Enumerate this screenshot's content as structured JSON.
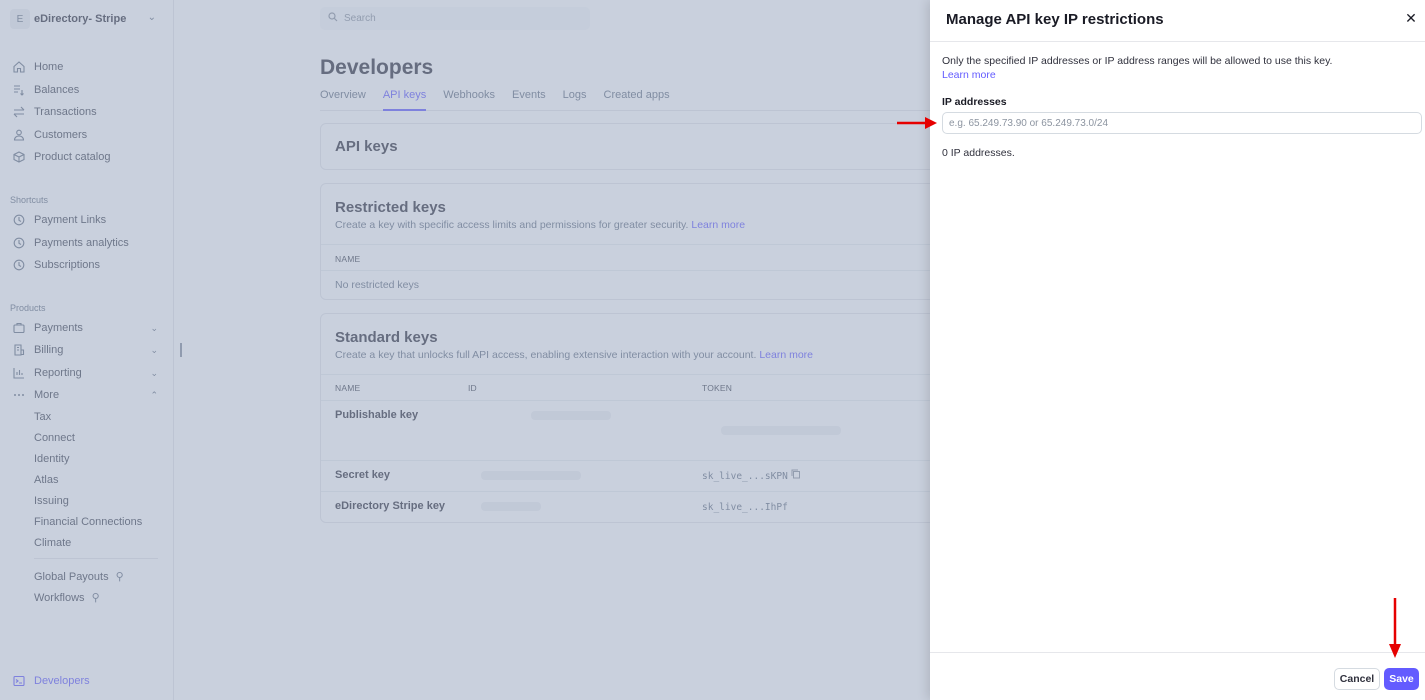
{
  "account": {
    "avatar_letter": "E",
    "name": "eDirectory- Stripe"
  },
  "search": {
    "placeholder": "Search"
  },
  "sidebar": {
    "main_items": [
      {
        "label": "Home",
        "icon": "home-icon"
      },
      {
        "label": "Balances",
        "icon": "balances-icon"
      },
      {
        "label": "Transactions",
        "icon": "transactions-icon"
      },
      {
        "label": "Customers",
        "icon": "customers-icon"
      },
      {
        "label": "Product catalog",
        "icon": "product-catalog-icon"
      }
    ],
    "shortcuts_label": "Shortcuts",
    "shortcuts": [
      {
        "label": "Payment Links",
        "icon": "clock-icon"
      },
      {
        "label": "Payments analytics",
        "icon": "clock-icon"
      },
      {
        "label": "Subscriptions",
        "icon": "clock-icon"
      }
    ],
    "products_label": "Products",
    "products": [
      {
        "label": "Payments",
        "icon": "payments-icon"
      },
      {
        "label": "Billing",
        "icon": "billing-icon"
      },
      {
        "label": "Reporting",
        "icon": "reporting-icon"
      },
      {
        "label": "More",
        "icon": "more-icon"
      }
    ],
    "more_items": [
      "Tax",
      "Connect",
      "Identity",
      "Atlas",
      "Issuing",
      "Financial Connections",
      "Climate"
    ],
    "extra_items": [
      "Global Payouts",
      "Workflows"
    ],
    "developers": "Developers"
  },
  "page": {
    "title": "Developers",
    "tabs": [
      "Overview",
      "API keys",
      "Webhooks",
      "Events",
      "Logs",
      "Created apps"
    ],
    "active_tab": "API keys"
  },
  "api_keys_card": {
    "title": "API keys"
  },
  "restricted": {
    "title": "Restricted keys",
    "desc": "Create a key with specific access limits and permissions for greater security.",
    "link": "Learn more",
    "col_name": "NAME",
    "empty": "No restricted keys"
  },
  "standard": {
    "title": "Standard keys",
    "desc": "Create a key that unlocks full API access, enabling extensive interaction with your account.",
    "link": "Learn more",
    "col_name": "NAME",
    "col_id": "ID",
    "col_token": "TOKEN",
    "rows": [
      {
        "name": "Publishable key",
        "token": ""
      },
      {
        "name": "Secret key",
        "token": "sk_live_...sKPN"
      },
      {
        "name": "eDirectory Stripe key",
        "token": "sk_live_...IhPf"
      }
    ]
  },
  "drawer": {
    "title": "Manage API key IP restrictions",
    "desc": "Only the specified IP addresses or IP address ranges will be allowed to use this key.",
    "link": "Learn more",
    "field_label": "IP addresses",
    "input_placeholder": "e.g. 65.249.73.90 or 65.249.73.0/24",
    "input_value": "",
    "count_text": "0 IP addresses.",
    "cancel": "Cancel",
    "save": "Save"
  },
  "colors": {
    "accent": "#635bff",
    "annotation": "#e60000"
  }
}
